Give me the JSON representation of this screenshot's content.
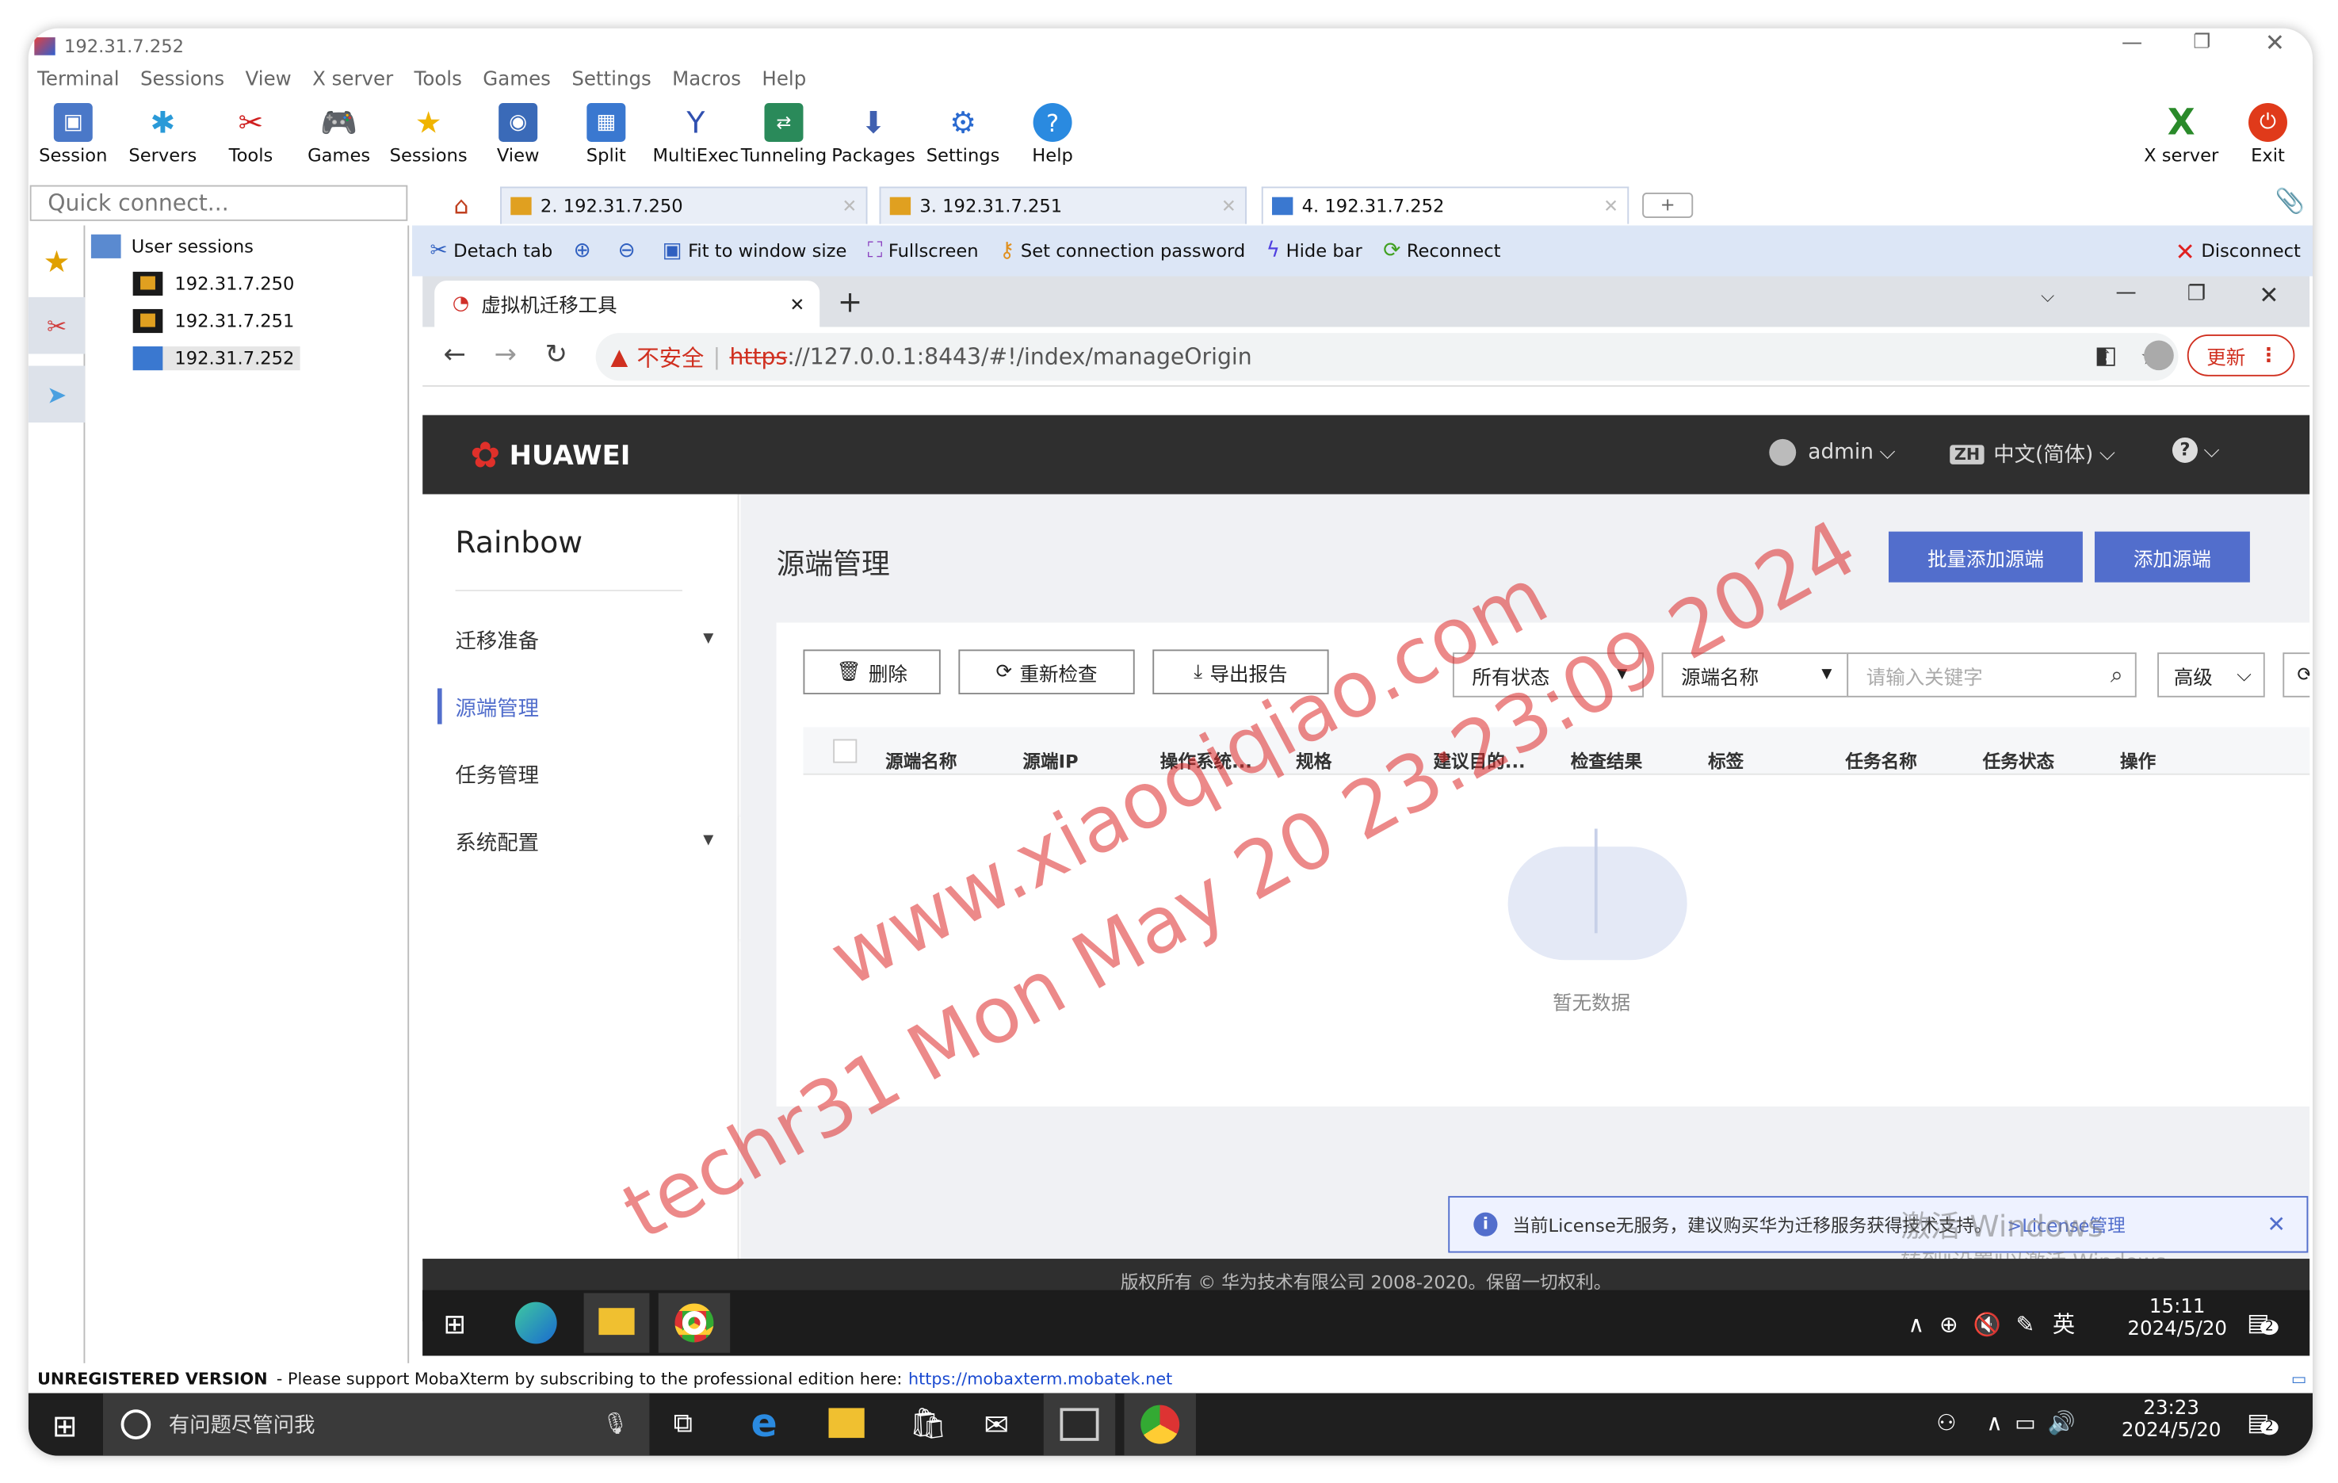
{
  "window": {
    "title": "192.31.7.252"
  },
  "menu": [
    "Terminal",
    "Sessions",
    "View",
    "X server",
    "Tools",
    "Games",
    "Settings",
    "Macros",
    "Help"
  ],
  "toolbar": {
    "session": "Session",
    "servers": "Servers",
    "tools": "Tools",
    "games": "Games",
    "sessions": "Sessions",
    "view": "View",
    "split": "Split",
    "multiexec": "MultiExec",
    "tunneling": "Tunneling",
    "packages": "Packages",
    "settings": "Settings",
    "help": "Help",
    "xserver": "X server",
    "exit": "Exit"
  },
  "quick_connect": {
    "placeholder": "Quick connect..."
  },
  "tabs": [
    "2. 192.31.7.250",
    "3. 192.31.7.251",
    "4. 192.31.7.252"
  ],
  "session_toolbar": {
    "detach": "Detach tab",
    "fit": "Fit to window size",
    "fullscreen": "Fullscreen",
    "set_password": "Set connection password",
    "hide_bar": "Hide bar",
    "reconnect": "Reconnect",
    "disconnect": "Disconnect"
  },
  "sidebar": {
    "root": "User sessions",
    "items": [
      "192.31.7.250",
      "192.31.7.251",
      "192.31.7.252"
    ]
  },
  "browser": {
    "tab_title": "虚拟机迁移工具",
    "not_secure": "不安全",
    "url_scheme": "https",
    "url_rest": "://127.0.0.1:8443/#!/index/manageOrigin",
    "update": "更新"
  },
  "app": {
    "brand": "HUAWEI",
    "user": "admin",
    "lang_badge": "ZH",
    "lang": "中文(简体)",
    "nav_title": "Rainbow",
    "nav": [
      "迁移准备",
      "源端管理",
      "任务管理",
      "系统配置"
    ],
    "page_title": "源端管理",
    "btn_batch_add": "批量添加源端",
    "btn_add": "添加源端",
    "btn_delete": "删除",
    "btn_recheck": "重新检查",
    "btn_export": "导出报告",
    "status_select": "所有状态",
    "filter_select": "源端名称",
    "search_placeholder": "请输入关键字",
    "advanced": "高级",
    "columns": [
      "源端名称",
      "源端IP",
      "操作系统...",
      "规格",
      "建议目的...",
      "检查结果",
      "标签",
      "任务名称",
      "任务状态",
      "操作"
    ],
    "empty": "暂无数据",
    "license_msg": "当前License无服务，建议购买华为迁移服务获得技术支持。",
    "license_link": ">License管理",
    "footer": "版权所有 © 华为技术有限公司 2008-2020。保留一切权利。",
    "activate1": "激活 Windows",
    "activate2": "转到\"设置\"以激活 Windows。"
  },
  "remote_taskbar": {
    "ime": "英",
    "time": "15:11",
    "date": "2024/5/20",
    "notif": "2"
  },
  "status_bar": {
    "bold": "UNREGISTERED VERSION",
    "text": "-  Please support MobaXterm by subscribing to the professional edition here:",
    "link": "https://mobaxterm.mobatek.net"
  },
  "host_taskbar": {
    "search": "有问题尽管问我",
    "time": "23:23",
    "date": "2024/5/20",
    "notif": "2"
  },
  "watermark": {
    "line1": "www.xiaoqiqiao.com",
    "line2": "techr31 Mon May 20 23:23:09 2024"
  }
}
